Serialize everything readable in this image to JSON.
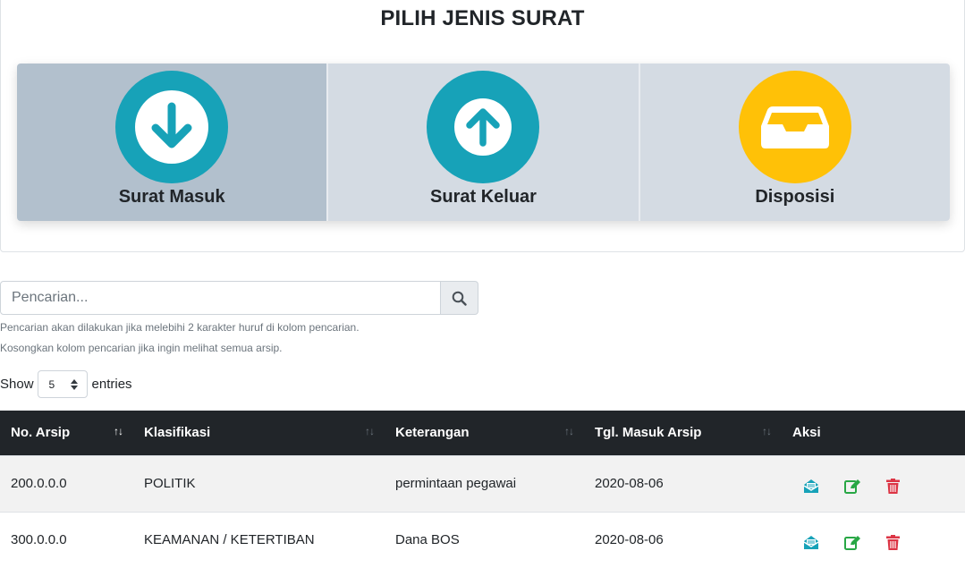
{
  "header": {
    "title": "PILIH JENIS SURAT"
  },
  "cards": [
    {
      "label": "Surat Masuk",
      "icon": "arrow-down-circle-icon",
      "color": "#17a2b8"
    },
    {
      "label": "Surat Keluar",
      "icon": "arrow-up-circle-icon",
      "color": "#17a2b8"
    },
    {
      "label": "Disposisi",
      "icon": "inbox-tray-icon",
      "color": "#ffc107"
    }
  ],
  "search": {
    "placeholder": "Pencarian...",
    "value": "",
    "hint1": "Pencarian akan dilakukan jika melebihi 2 karakter huruf di kolom pencarian.",
    "hint2": "Kosongkan kolom pencarian jika ingin melihat semua arsip."
  },
  "entries": {
    "show": "Show",
    "value": "5",
    "suffix": "entries"
  },
  "table": {
    "columns": [
      "No. Arsip",
      "Klasifikasi",
      "Keterangan",
      "Tgl. Masuk Arsip",
      "Aksi"
    ],
    "rows": [
      {
        "no_arsip": "200.0.0.0",
        "klasifikasi": "POLITIK",
        "keterangan": "permintaan pegawai",
        "tgl": "2020-08-06"
      },
      {
        "no_arsip": "300.0.0.0",
        "klasifikasi": "KEAMANAN / KETERTIBAN",
        "keterangan": "Dana BOS",
        "tgl": "2020-08-06"
      }
    ]
  },
  "colors": {
    "info": "#17a2b8",
    "warning": "#ffc107",
    "success": "#28a745",
    "danger": "#dc3545",
    "header_bg": "#212529"
  }
}
